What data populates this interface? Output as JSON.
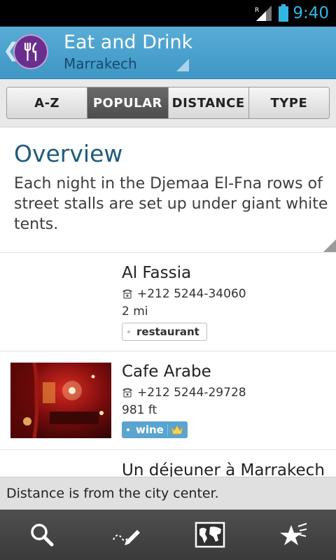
{
  "status_bar": {
    "time": "9:40",
    "signal_badge": "R",
    "signal_icon": "signal-icon",
    "battery_icon": "battery-icon"
  },
  "header": {
    "title": "Eat and Drink",
    "subtitle": "Marrakech",
    "back_icon": "chevron-left-icon",
    "app_icon": "fork-knife-icon",
    "accent_color": "#3f97c5",
    "icon_color": "#6a2f8e"
  },
  "tabs": [
    {
      "label": "A-Z",
      "active": false
    },
    {
      "label": "POPULAR",
      "active": true
    },
    {
      "label": "DISTANCE",
      "active": false
    },
    {
      "label": "TYPE",
      "active": false
    }
  ],
  "overview": {
    "heading": "Overview",
    "text": "Each night in the Djemaa El-Fna rows of street stalls are set up under giant white tents."
  },
  "places": [
    {
      "name": "Al Fassia",
      "phone": "+212 5244-34060",
      "distance": "2 mi",
      "tag": "restaurant",
      "has_photo": false
    },
    {
      "name": "Cafe Arabe",
      "phone": "+212 5244-29728",
      "distance": "981 ft",
      "tag": "wine",
      "has_photo": true,
      "tag_icon": "crown-icon"
    },
    {
      "name": "Un déjeuner à Marrakech"
    }
  ],
  "distance_note": "Distance is from the city center.",
  "bottom_bar": [
    {
      "icon": "search-icon"
    },
    {
      "icon": "pen-icon"
    },
    {
      "icon": "map-icon"
    },
    {
      "icon": "star-icon"
    }
  ]
}
